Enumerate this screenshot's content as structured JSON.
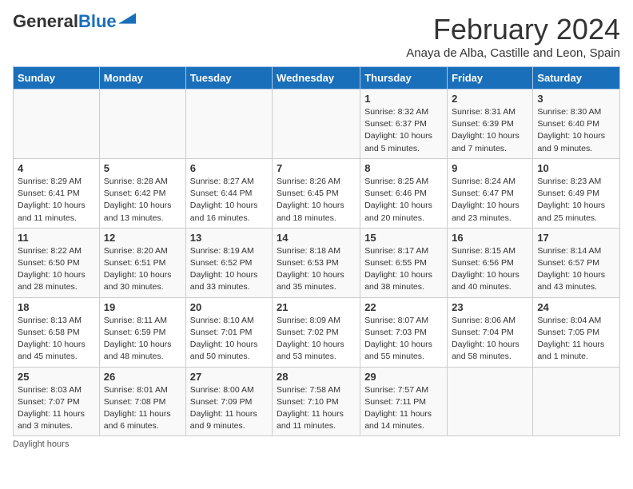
{
  "header": {
    "logo_general": "General",
    "logo_blue": "Blue",
    "month_title": "February 2024",
    "subtitle": "Anaya de Alba, Castille and Leon, Spain"
  },
  "days_of_week": [
    "Sunday",
    "Monday",
    "Tuesday",
    "Wednesday",
    "Thursday",
    "Friday",
    "Saturday"
  ],
  "weeks": [
    [
      {
        "day": "",
        "info": ""
      },
      {
        "day": "",
        "info": ""
      },
      {
        "day": "",
        "info": ""
      },
      {
        "day": "",
        "info": ""
      },
      {
        "day": "1",
        "info": "Sunrise: 8:32 AM\nSunset: 6:37 PM\nDaylight: 10 hours and 5 minutes."
      },
      {
        "day": "2",
        "info": "Sunrise: 8:31 AM\nSunset: 6:39 PM\nDaylight: 10 hours and 7 minutes."
      },
      {
        "day": "3",
        "info": "Sunrise: 8:30 AM\nSunset: 6:40 PM\nDaylight: 10 hours and 9 minutes."
      }
    ],
    [
      {
        "day": "4",
        "info": "Sunrise: 8:29 AM\nSunset: 6:41 PM\nDaylight: 10 hours and 11 minutes."
      },
      {
        "day": "5",
        "info": "Sunrise: 8:28 AM\nSunset: 6:42 PM\nDaylight: 10 hours and 13 minutes."
      },
      {
        "day": "6",
        "info": "Sunrise: 8:27 AM\nSunset: 6:44 PM\nDaylight: 10 hours and 16 minutes."
      },
      {
        "day": "7",
        "info": "Sunrise: 8:26 AM\nSunset: 6:45 PM\nDaylight: 10 hours and 18 minutes."
      },
      {
        "day": "8",
        "info": "Sunrise: 8:25 AM\nSunset: 6:46 PM\nDaylight: 10 hours and 20 minutes."
      },
      {
        "day": "9",
        "info": "Sunrise: 8:24 AM\nSunset: 6:47 PM\nDaylight: 10 hours and 23 minutes."
      },
      {
        "day": "10",
        "info": "Sunrise: 8:23 AM\nSunset: 6:49 PM\nDaylight: 10 hours and 25 minutes."
      }
    ],
    [
      {
        "day": "11",
        "info": "Sunrise: 8:22 AM\nSunset: 6:50 PM\nDaylight: 10 hours and 28 minutes."
      },
      {
        "day": "12",
        "info": "Sunrise: 8:20 AM\nSunset: 6:51 PM\nDaylight: 10 hours and 30 minutes."
      },
      {
        "day": "13",
        "info": "Sunrise: 8:19 AM\nSunset: 6:52 PM\nDaylight: 10 hours and 33 minutes."
      },
      {
        "day": "14",
        "info": "Sunrise: 8:18 AM\nSunset: 6:53 PM\nDaylight: 10 hours and 35 minutes."
      },
      {
        "day": "15",
        "info": "Sunrise: 8:17 AM\nSunset: 6:55 PM\nDaylight: 10 hours and 38 minutes."
      },
      {
        "day": "16",
        "info": "Sunrise: 8:15 AM\nSunset: 6:56 PM\nDaylight: 10 hours and 40 minutes."
      },
      {
        "day": "17",
        "info": "Sunrise: 8:14 AM\nSunset: 6:57 PM\nDaylight: 10 hours and 43 minutes."
      }
    ],
    [
      {
        "day": "18",
        "info": "Sunrise: 8:13 AM\nSunset: 6:58 PM\nDaylight: 10 hours and 45 minutes."
      },
      {
        "day": "19",
        "info": "Sunrise: 8:11 AM\nSunset: 6:59 PM\nDaylight: 10 hours and 48 minutes."
      },
      {
        "day": "20",
        "info": "Sunrise: 8:10 AM\nSunset: 7:01 PM\nDaylight: 10 hours and 50 minutes."
      },
      {
        "day": "21",
        "info": "Sunrise: 8:09 AM\nSunset: 7:02 PM\nDaylight: 10 hours and 53 minutes."
      },
      {
        "day": "22",
        "info": "Sunrise: 8:07 AM\nSunset: 7:03 PM\nDaylight: 10 hours and 55 minutes."
      },
      {
        "day": "23",
        "info": "Sunrise: 8:06 AM\nSunset: 7:04 PM\nDaylight: 10 hours and 58 minutes."
      },
      {
        "day": "24",
        "info": "Sunrise: 8:04 AM\nSunset: 7:05 PM\nDaylight: 11 hours and 1 minute."
      }
    ],
    [
      {
        "day": "25",
        "info": "Sunrise: 8:03 AM\nSunset: 7:07 PM\nDaylight: 11 hours and 3 minutes."
      },
      {
        "day": "26",
        "info": "Sunrise: 8:01 AM\nSunset: 7:08 PM\nDaylight: 11 hours and 6 minutes."
      },
      {
        "day": "27",
        "info": "Sunrise: 8:00 AM\nSunset: 7:09 PM\nDaylight: 11 hours and 9 minutes."
      },
      {
        "day": "28",
        "info": "Sunrise: 7:58 AM\nSunset: 7:10 PM\nDaylight: 11 hours and 11 minutes."
      },
      {
        "day": "29",
        "info": "Sunrise: 7:57 AM\nSunset: 7:11 PM\nDaylight: 11 hours and 14 minutes."
      },
      {
        "day": "",
        "info": ""
      },
      {
        "day": "",
        "info": ""
      }
    ]
  ],
  "footer": "Daylight hours"
}
